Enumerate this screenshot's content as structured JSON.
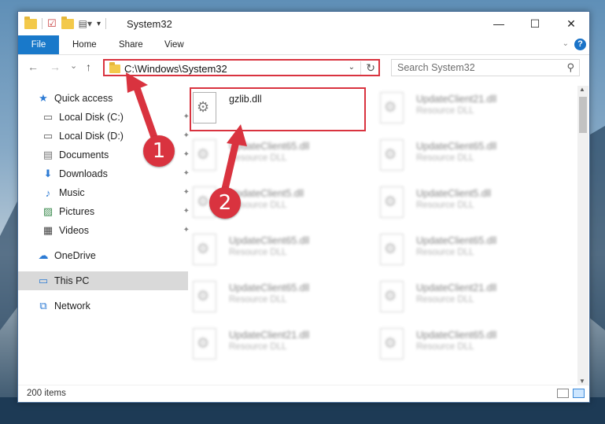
{
  "window": {
    "title": "System32",
    "minimize_glyph": "—",
    "maximize_glyph": "☐",
    "close_glyph": "✕"
  },
  "ribbon": {
    "tabs": [
      "File",
      "Home",
      "Share",
      "View"
    ],
    "help_glyph": "?"
  },
  "nav": {
    "back_glyph": "←",
    "forward_glyph": "→",
    "recent_glyph": "⌄",
    "up_glyph": "↑"
  },
  "address": {
    "path": "C:\\Windows\\System32"
  },
  "search": {
    "placeholder": "Search System32"
  },
  "sidebar": {
    "items": [
      {
        "label": "Quick access",
        "icon": "star-icon",
        "glyph": "★",
        "pinned": false
      },
      {
        "label": "Local Disk (C:)",
        "icon": "drive-icon",
        "glyph": "▭",
        "pinned": true
      },
      {
        "label": "Local Disk (D:)",
        "icon": "drive-icon",
        "glyph": "▭",
        "pinned": true
      },
      {
        "label": "Documents",
        "icon": "documents-icon",
        "glyph": "▤",
        "pinned": true
      },
      {
        "label": "Downloads",
        "icon": "download-icon",
        "glyph": "⬇",
        "pinned": true
      },
      {
        "label": "Music",
        "icon": "music-icon",
        "glyph": "♪",
        "pinned": true
      },
      {
        "label": "Pictures",
        "icon": "pictures-icon",
        "glyph": "▨",
        "pinned": true
      },
      {
        "label": "Videos",
        "icon": "videos-icon",
        "glyph": "▦",
        "pinned": true
      },
      {
        "label": "OneDrive",
        "icon": "cloud-icon",
        "glyph": "☁",
        "pinned": false
      },
      {
        "label": "This PC",
        "icon": "computer-icon",
        "glyph": "▭",
        "pinned": false
      },
      {
        "label": "Network",
        "icon": "network-icon",
        "glyph": "⧉",
        "pinned": false
      }
    ],
    "pin_glyph": "📌"
  },
  "files": [
    {
      "name": "gzlib.dll",
      "type": "",
      "highlighted": true
    },
    {
      "name": "UpdateClient21.dll",
      "type": "Resource DLL",
      "highlighted": false
    },
    {
      "name": "UpdateClient65.dll",
      "type": "Resource DLL",
      "highlighted": false
    },
    {
      "name": "UpdateClient65.dll",
      "type": "Resource DLL",
      "highlighted": false
    },
    {
      "name": "UpdateClient5.dll",
      "type": "Resource DLL",
      "highlighted": false
    },
    {
      "name": "UpdateClient5.dll",
      "type": "Resource DLL",
      "highlighted": false
    },
    {
      "name": "UpdateClient65.dll",
      "type": "Resource DLL",
      "highlighted": false
    },
    {
      "name": "UpdateClient65.dll",
      "type": "Resource DLL",
      "highlighted": false
    },
    {
      "name": "UpdateClient65.dll",
      "type": "Resource DLL",
      "highlighted": false
    },
    {
      "name": "UpdateClient21.dll",
      "type": "Resource DLL",
      "highlighted": false
    },
    {
      "name": "UpdateClient21.dll",
      "type": "Resource DLL",
      "highlighted": false
    },
    {
      "name": "UpdateClient65.dll",
      "type": "Resource DLL",
      "highlighted": false
    }
  ],
  "status": {
    "item_count": "200 items"
  },
  "annotations": {
    "step1": "1",
    "step2": "2",
    "color": "#d9333f"
  }
}
